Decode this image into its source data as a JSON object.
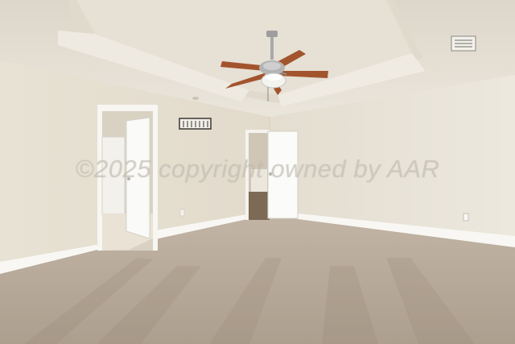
{
  "watermark": {
    "text": "©2025 copyright owned by AAR"
  },
  "colors": {
    "ceiling": "#e7e2d8",
    "wall_left": "#e6e0d2",
    "wall_right": "#e9e4d9",
    "carpet": "#b5a796",
    "baseboard": "#f8f7f3",
    "door": "#f6f6f4",
    "fan_blade": "#a2542d",
    "fan_metal": "#a9a9a9"
  }
}
